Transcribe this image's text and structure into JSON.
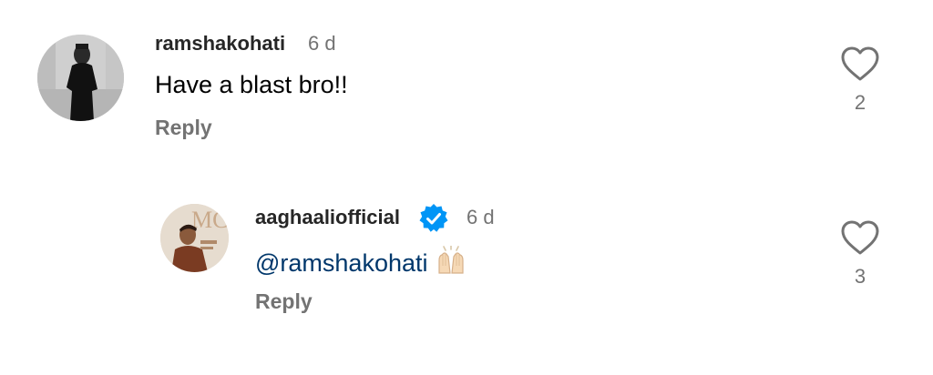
{
  "comments": [
    {
      "username": "ramshakohati",
      "time": "6 d",
      "text": "Have a blast bro!!",
      "reply_label": "Reply",
      "likes": "2",
      "verified": false
    }
  ],
  "replies": [
    {
      "username": "aaghaaliofficial",
      "time": "6 d",
      "mention": "@ramshakohati",
      "emoji": "raised-hands-icon",
      "reply_label": "Reply",
      "likes": "3",
      "verified": true
    }
  ],
  "colors": {
    "username": "#262626",
    "secondary": "#737373",
    "mention": "#00376b",
    "verified_badge": "#0095f6"
  }
}
